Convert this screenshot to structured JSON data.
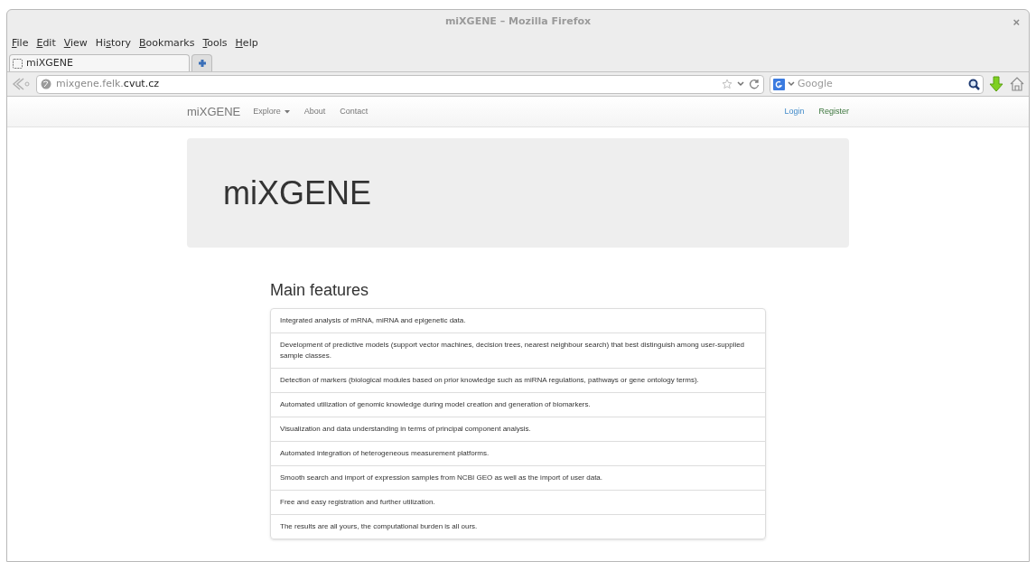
{
  "window": {
    "title": "miXGENE – Mozilla Firefox",
    "close": "×"
  },
  "menu": [
    {
      "key": "F",
      "after": "ile"
    },
    {
      "key": "E",
      "after": "dit"
    },
    {
      "key": "V",
      "after": "iew"
    },
    {
      "before": "Hi",
      "key": "s",
      "after": "tory"
    },
    {
      "key": "B",
      "after": "ookmarks"
    },
    {
      "key": "T",
      "after": "ools"
    },
    {
      "key": "H",
      "after": "elp"
    }
  ],
  "tabs": [
    {
      "label": "miXGENE",
      "selected": true
    }
  ],
  "address_bar": {
    "url_host_prefix": "mixgene.felk.",
    "url_domain": "cvut.cz"
  },
  "search_bar": {
    "placeholder": "Google"
  },
  "site_nav": {
    "brand": "miXGENE",
    "links": [
      {
        "label": "Explore",
        "dropdown": true
      },
      {
        "label": "About",
        "dropdown": false
      },
      {
        "label": "Contact",
        "dropdown": false
      }
    ],
    "right_links": [
      {
        "label": "Login"
      },
      {
        "label": "Register"
      }
    ]
  },
  "jumbotron": {
    "title": "miXGENE"
  },
  "features": {
    "heading": "Main features",
    "items": [
      "Integrated analysis of mRNA, miRNA and epigenetic data.",
      "Development of predictive models (support vector machines, decision trees, nearest neighbour search) that best distinguish among user-supplied sample classes.",
      "Detection of markers (biological modules based on prior knowledge such as miRNA regulations, pathways or gene ontology terms).",
      "Automated utilization of genomic knowledge during model creation and generation of biomarkers.",
      "Visualization and data understanding in terms of principal component analysis.",
      "Automated integration of heterogeneous measurement platforms.",
      "Smooth search and import of expression samples from NCBI GEO as well as the import of user data.",
      "Free and easy registration and further utilization.",
      "The results are all yours, the computational burden is all ours."
    ]
  }
}
